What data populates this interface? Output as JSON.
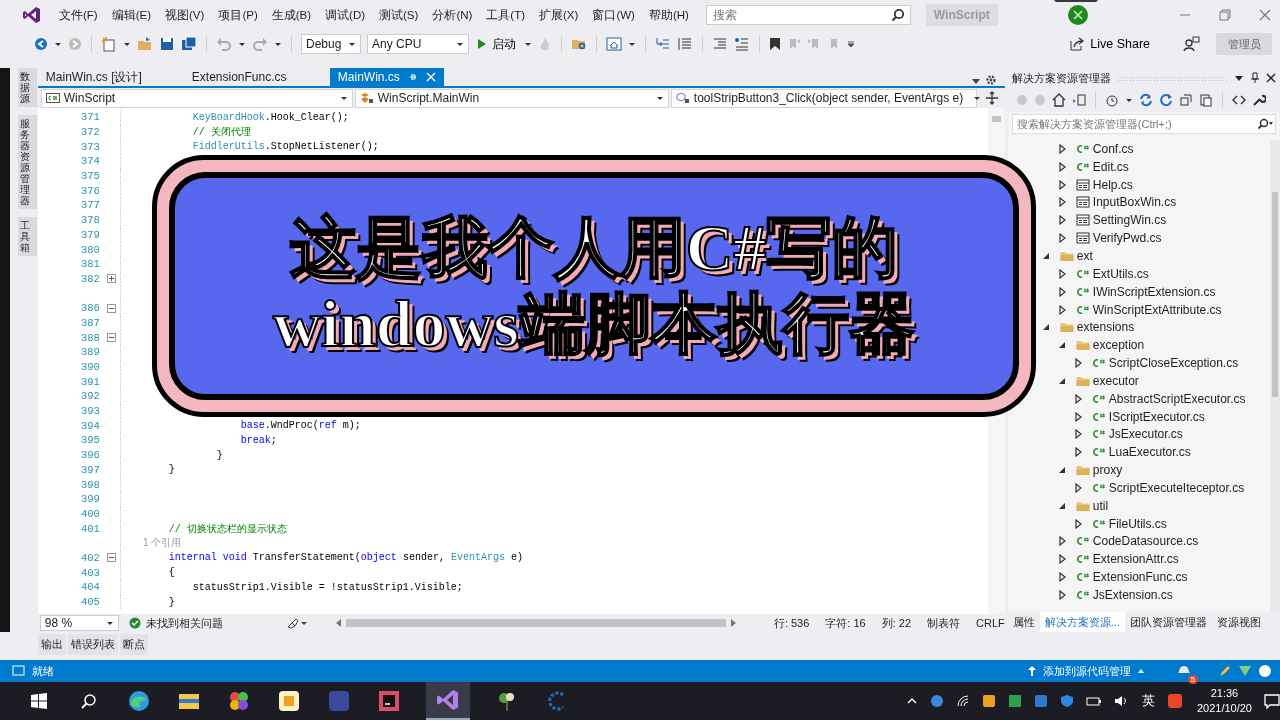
{
  "window": {
    "menu": [
      "文件(F)",
      "编辑(E)",
      "视图(V)",
      "项目(P)",
      "生成(B)",
      "调试(D)",
      "测试(S)",
      "分析(N)",
      "工具(T)",
      "扩展(X)",
      "窗口(W)",
      "帮助(H)"
    ],
    "search": {
      "placeholder": "搜索"
    },
    "solution_badge": "WinScript"
  },
  "toolbar": {
    "configuration": "Debug",
    "platform": "Any CPU",
    "start": "启动",
    "live_share": "Live Share",
    "admin": "管理员"
  },
  "side_tabs": [
    "数据源",
    "服务器资源管理器",
    "工具箱"
  ],
  "editor": {
    "tabs": [
      {
        "label": "MainWin.cs [设计]",
        "selected": false
      },
      {
        "label": "ExtensionFunc.cs",
        "selected": false
      },
      {
        "label": "MainWin.cs",
        "selected": true
      }
    ],
    "nav": {
      "project": "WinScript",
      "class": "WinScript.MainWin",
      "member": "toolStripButton3_Click(object sender, EventArgs e)"
    },
    "lines": [
      {
        "kind": "code",
        "num": "371",
        "parts": [
          {
            "t": "            KeyBoardHook",
            "kind": "type"
          },
          {
            "t": ".Hook_Clear();",
            "kind": "plain"
          }
        ]
      },
      {
        "kind": "code",
        "num": "372",
        "parts": [
          {
            "t": "            // 关闭代理",
            "kind": "comment"
          }
        ]
      },
      {
        "kind": "code",
        "num": "373",
        "parts": [
          {
            "t": "            FiddlerUtils",
            "kind": "type"
          },
          {
            "t": ".StopNetListener();",
            "kind": "plain"
          }
        ]
      },
      {
        "kind": "code",
        "num": "374"
      },
      {
        "kind": "code",
        "num": "375"
      },
      {
        "kind": "code",
        "num": "376"
      },
      {
        "kind": "code",
        "num": "377"
      },
      {
        "kind": "code",
        "num": "378"
      },
      {
        "kind": "code",
        "num": "379"
      },
      {
        "kind": "code",
        "num": "380"
      },
      {
        "kind": "code",
        "num": "381"
      },
      {
        "kind": "code",
        "num": "382",
        "collapsed": true
      },
      {
        "kind": "spacer"
      },
      {
        "kind": "code",
        "num": "386",
        "collapsed": false
      },
      {
        "kind": "code",
        "num": "387"
      },
      {
        "kind": "code",
        "num": "388",
        "collapsed": false
      },
      {
        "kind": "code",
        "num": "389"
      },
      {
        "kind": "code",
        "num": "390"
      },
      {
        "kind": "code",
        "num": "391"
      },
      {
        "kind": "code",
        "num": "392"
      },
      {
        "kind": "code",
        "num": "393"
      },
      {
        "kind": "code",
        "num": "394",
        "parts": [
          {
            "t": "                    base",
            "kind": "kw"
          },
          {
            "t": ".WndProc(",
            "kind": "plain"
          },
          {
            "t": "ref",
            "kind": "kw"
          },
          {
            "t": " m);",
            "kind": "plain"
          }
        ]
      },
      {
        "kind": "code",
        "num": "395",
        "parts": [
          {
            "t": "                    break",
            "kind": "kw"
          },
          {
            "t": ";",
            "kind": "plain"
          }
        ]
      },
      {
        "kind": "code",
        "num": "396",
        "parts": [
          {
            "t": "                }",
            "kind": "plain"
          }
        ]
      },
      {
        "kind": "code",
        "num": "397",
        "parts": [
          {
            "t": "        }",
            "kind": "plain"
          }
        ]
      },
      {
        "kind": "code",
        "num": "398"
      },
      {
        "kind": "code",
        "num": "399"
      },
      {
        "kind": "code",
        "num": "400"
      },
      {
        "kind": "code",
        "num": "401",
        "parts": [
          {
            "t": "        // 切换状态栏的显示状态",
            "kind": "comment"
          }
        ]
      },
      {
        "kind": "codelens",
        "text": "        1 个引用"
      },
      {
        "kind": "code",
        "num": "402",
        "collapsed": false,
        "parts": [
          {
            "t": "        internal",
            "kind": "kw"
          },
          {
            "t": " void",
            "kind": "kw"
          },
          {
            "t": " TransferStatement(",
            "kind": "plain"
          },
          {
            "t": "object",
            "kind": "kw"
          },
          {
            "t": " sender, ",
            "kind": "plain"
          },
          {
            "t": "EventArgs",
            "kind": "type"
          },
          {
            "t": " e)",
            "kind": "plain"
          }
        ]
      },
      {
        "kind": "code",
        "num": "403",
        "parts": [
          {
            "t": "        {",
            "kind": "plain"
          }
        ]
      },
      {
        "kind": "code",
        "num": "404",
        "parts": [
          {
            "t": "            statusStrip1.Visible = !statusStrip1.Visible;",
            "kind": "plain"
          }
        ]
      },
      {
        "kind": "code",
        "num": "405",
        "parts": [
          {
            "t": "        }",
            "kind": "plain"
          }
        ]
      }
    ],
    "status": {
      "zoom": "98 %",
      "issues": "未找到相关问题",
      "line": "行: 536",
      "char": "字符: 16",
      "col": "列: 22",
      "tabs": "制表符",
      "eol": "CRLF"
    }
  },
  "solution_explorer": {
    "title": "解决方案资源管理器",
    "search": {
      "placeholder": "搜索解决方案资源管理器(Ctrl+;)"
    },
    "tree": [
      {
        "kind": "group",
        "children": [
          {
            "label": "Conf.cs",
            "kind": "file",
            "expanded": false
          },
          {
            "label": "Edit.cs",
            "kind": "file",
            "expanded": false
          },
          {
            "label": "Help.cs",
            "kind": "form",
            "expanded": false
          },
          {
            "label": "InputBoxWin.cs",
            "kind": "form",
            "expanded": false
          },
          {
            "label": "SettingWin.cs",
            "kind": "form",
            "expanded": false
          },
          {
            "label": "VerifyPwd.cs",
            "kind": "form",
            "expanded": false
          }
        ]
      },
      {
        "label": "ext",
        "kind": "folder",
        "expanded": true,
        "children": [
          {
            "label": "ExtUtils.cs",
            "kind": "file",
            "expanded": false
          },
          {
            "label": "IWinScriptExtension.cs",
            "kind": "file",
            "expanded": false
          },
          {
            "label": "WinScriptExtAttribute.cs",
            "kind": "file",
            "expanded": false
          }
        ]
      },
      {
        "label": "extensions",
        "kind": "folder",
        "expanded": true,
        "children": [
          {
            "label": "exception",
            "kind": "folder",
            "expanded": true,
            "children": [
              {
                "label": "ScriptCloseException.cs",
                "kind": "file",
                "expanded": false
              }
            ]
          },
          {
            "label": "executor",
            "kind": "folder",
            "expanded": true,
            "children": [
              {
                "label": "AbstractScriptExecutor.cs",
                "kind": "file",
                "expanded": false
              },
              {
                "label": "IScriptExecutor.cs",
                "kind": "file",
                "expanded": false
              },
              {
                "label": "JsExecutor.cs",
                "kind": "file",
                "expanded": false
              },
              {
                "label": "LuaExecutor.cs",
                "kind": "file",
                "expanded": false
              }
            ]
          },
          {
            "label": "proxy",
            "kind": "folder",
            "expanded": true,
            "children": [
              {
                "label": "ScriptExecuteIteceptor.cs",
                "kind": "file",
                "expanded": false
              }
            ]
          },
          {
            "label": "util",
            "kind": "folder",
            "expanded": true,
            "children": [
              {
                "label": "FileUtils.cs",
                "kind": "file",
                "expanded": false
              }
            ]
          },
          {
            "label": "CodeDatasource.cs",
            "kind": "file",
            "expanded": false
          },
          {
            "label": "ExtensionAttr.cs",
            "kind": "file",
            "expanded": false
          },
          {
            "label": "ExtensionFunc.cs",
            "kind": "file",
            "expanded": false
          },
          {
            "label": "JsExtension.cs",
            "kind": "file",
            "expanded": false
          }
        ]
      }
    ],
    "tabs": [
      {
        "label": "属性",
        "selected": false
      },
      {
        "label": "解决方案资源...",
        "selected": true
      },
      {
        "label": "团队资源管理器",
        "selected": false
      },
      {
        "label": "资源视图",
        "selected": false
      }
    ]
  },
  "tool_tabs": [
    "输出",
    "错误列表",
    "断点"
  ],
  "status_bar": {
    "text": "就绪",
    "source_control": "添加到源代码管理",
    "notifications": "5"
  },
  "taskbar": {
    "ime": "英",
    "time": "21:36",
    "date": "2021/10/20"
  },
  "caption": {
    "lines": [
      "这是我个人用C#写的",
      "windows端脚本执行器"
    ]
  }
}
